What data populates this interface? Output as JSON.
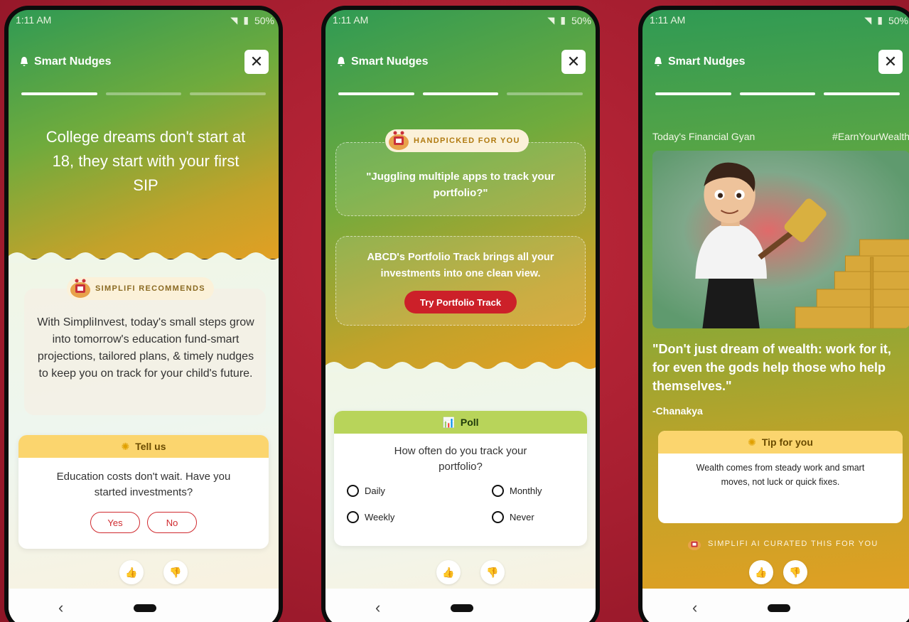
{
  "status_bar": {
    "time": "1:11 AM",
    "battery": "50%"
  },
  "header": {
    "title": "Smart Nudges",
    "close_label": "✕"
  },
  "nav": {
    "back_label": "‹"
  },
  "thumbs": {
    "up": "👍",
    "down": "👎"
  },
  "screen1": {
    "headline": "College dreams don't start at 18, they start with your first SIP",
    "tag": "SIMPLIFI RECOMMENDS",
    "body": "With SimpliInvest, today's small steps grow into tomorrow's education fund-smart projections, tailored plans, & timely nudges to keep you on track for your child's future.",
    "survey_title": "Tell us",
    "question": "Education costs don't wait. Have you started investments?",
    "yes": "Yes",
    "no": "No"
  },
  "screen2": {
    "tag": "HANDPICKED FOR YOU",
    "quote": "\"Juggling multiple apps to track your portfolio?\"",
    "pitch": "ABCD's Portfolio Track brings all your investments into one clean view.",
    "cta": "Try Portfolio Track",
    "poll_title": "Poll",
    "poll_question": "How often do you track your portfolio?",
    "options": {
      "daily": "Daily",
      "monthly": "Monthly",
      "weekly": "Weekly",
      "never": "Never"
    }
  },
  "screen3": {
    "gyan_label": "Today's Financial Gyan",
    "hashtag": "#EarnYourWealth",
    "quote": "\"Don't just dream of wealth: work for it, for even the gods help those who help themselves.\"",
    "author": "-Chanakya",
    "tip_title": "Tip for you",
    "tip_text": "Wealth comes from steady work and smart moves, not luck or quick fixes.",
    "ai_label": "SIMPLIFI AI CURATED THIS FOR YOU"
  },
  "colors": {
    "accent_red": "#cc2029",
    "survey_yellow": "#fbd56e",
    "poll_green": "#b8d45a",
    "background": "#a61e30"
  }
}
